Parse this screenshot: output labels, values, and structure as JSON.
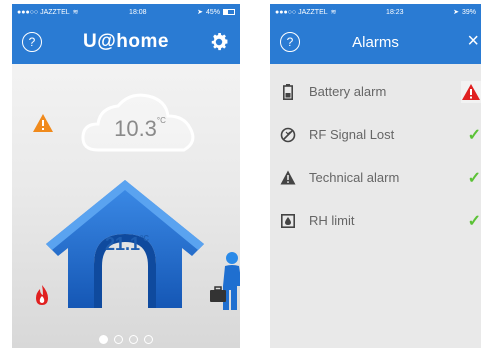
{
  "left_screen": {
    "status_bar": {
      "carrier": "●●●○○ JAZZTEL",
      "time": "18:08",
      "battery": "45%",
      "battery_level": 0.45
    },
    "title": "U@home",
    "help_label": "?",
    "outdoor_temp": "10.3",
    "indoor_temp": "21.1",
    "temp_unit": "°C",
    "page_dots": {
      "count": 4,
      "active": 1
    }
  },
  "right_screen": {
    "status_bar": {
      "carrier": "●●●○○ JAZZTEL",
      "time": "18:23",
      "battery": "39%",
      "battery_level": 0.39
    },
    "title": "Alarms",
    "help_label": "?",
    "close_label": "×",
    "alarms": [
      {
        "label": "Battery alarm",
        "icon": "battery-icon",
        "status": "alert"
      },
      {
        "label": "RF Signal Lost",
        "icon": "signal-lost-icon",
        "status": "ok"
      },
      {
        "label": "Technical alarm",
        "icon": "warning-icon",
        "status": "ok"
      },
      {
        "label": "RH limit",
        "icon": "humidity-icon",
        "status": "ok"
      }
    ],
    "ok_glyph": "✓",
    "alert_glyph": "!"
  },
  "colors": {
    "nav_blue": "#2a7bd3",
    "house_blue": "#1f6fd0",
    "warning_orange": "#f08a1c",
    "alert_red": "#e02020",
    "ok_green": "#5bc236"
  }
}
